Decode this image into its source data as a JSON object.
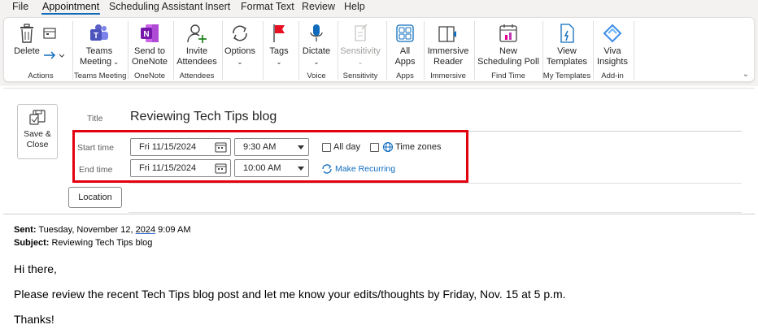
{
  "menu": {
    "tabs": [
      "File",
      "Appointment",
      "Scheduling Assistant",
      "Insert",
      "Format Text",
      "Review",
      "Help"
    ],
    "active": "Appointment"
  },
  "ribbon": {
    "actions": {
      "delete": "Delete",
      "group": "Actions"
    },
    "teams": {
      "line1": "Teams",
      "line2": "Meeting",
      "group": "Teams Meeting"
    },
    "onenote": {
      "line1": "Send to",
      "line2": "OneNote",
      "group": "OneNote"
    },
    "attendees": {
      "line1": "Invite",
      "line2": "Attendees",
      "group": "Attendees"
    },
    "options": {
      "label": "Options"
    },
    "tags": {
      "label": "Tags"
    },
    "voice": {
      "label": "Dictate",
      "group": "Voice"
    },
    "sensitivity": {
      "label": "Sensitivity",
      "group": "Sensitivity"
    },
    "apps": {
      "line1": "All",
      "line2": "Apps",
      "group": "Apps"
    },
    "immersive": {
      "line1": "Immersive",
      "line2": "Reader",
      "group": "Immersive"
    },
    "findtime": {
      "line1": "New",
      "line2": "Scheduling Poll",
      "group": "Find Time"
    },
    "templates": {
      "line1": "View",
      "line2": "Templates",
      "group": "My Templates"
    },
    "addin": {
      "line1": "Viva",
      "line2": "Insights",
      "group": "Add-in"
    }
  },
  "form": {
    "save_close": {
      "line1": "Save &",
      "line2": "Close"
    },
    "title_label": "Title",
    "title_value": "Reviewing Tech Tips blog",
    "start_label": "Start time",
    "start_date": "Fri 11/15/2024",
    "start_time": "9:30 AM",
    "end_label": "End time",
    "end_date": "Fri 11/15/2024",
    "end_time": "10:00 AM",
    "all_day": "All day",
    "time_zones": "Time zones",
    "make_recurring": "Make Recurring",
    "location": "Location"
  },
  "message": {
    "sent_label": "Sent:",
    "sent_prefix": "Tuesday, November 12, ",
    "sent_year": "2024",
    "sent_suffix": " 9:09 AM",
    "subject_label": "Subject:",
    "subject": "Reviewing Tech Tips blog",
    "greeting": "Hi there,",
    "body": "Please review the recent Tech Tips blog post and let me know your edits/thoughts by Friday, Nov. 15 at 5 p.m.",
    "closing": "Thanks!"
  },
  "colors": {
    "accent": "#0f6cbd",
    "highlight": "#e3000f",
    "onenote": "#7719aa",
    "teams": "#5b5fc7"
  }
}
